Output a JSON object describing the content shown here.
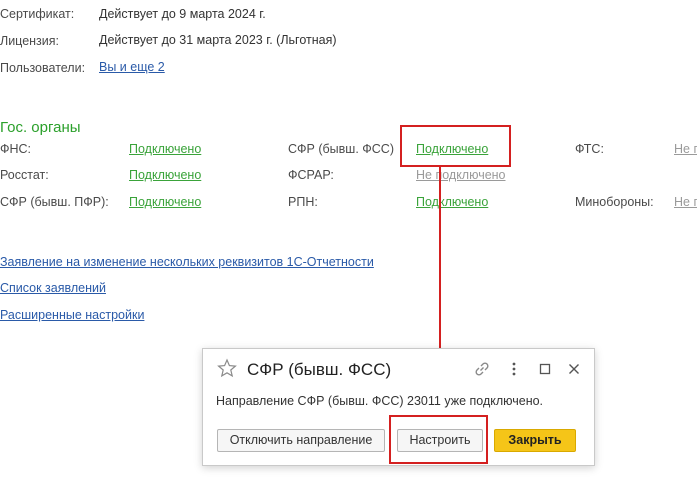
{
  "info": {
    "certificate_label": "Сертификат:",
    "certificate_value": "Действует до 9 марта 2024 г.",
    "license_label": "Лицензия:",
    "license_value": "Действует до 31 марта 2023 г. (Льготная)",
    "users_label": "Пользователи:",
    "users_link": "Вы и еще 2"
  },
  "agencies": {
    "title": "Гос. органы",
    "items": [
      {
        "name": "ФНС:",
        "status": "Подключено"
      },
      {
        "name": "СФР (бывш. ФСС)",
        "status": "Подключено"
      },
      {
        "name": "ФТС:",
        "status": "Не п"
      },
      {
        "name": "Росстат:",
        "status": "Подключено"
      },
      {
        "name": "ФСРАР:",
        "status": "Не подключено"
      },
      {
        "name": "СФР (бывш. ПФР):",
        "status": "Подключено"
      },
      {
        "name": "РПН:",
        "status": "Подключено"
      },
      {
        "name": "Минобороны:",
        "status": "Не п"
      }
    ]
  },
  "links": {
    "change_requisites": "Заявление на изменение нескольких реквизитов 1С-Отчетности",
    "applications_list": "Список заявлений",
    "advanced_settings": "Расширенные настройки"
  },
  "dialog": {
    "title": "СФР (бывш. ФСС)",
    "message": "Направление СФР (бывш. ФСС) 23011 уже подключено.",
    "disconnect_button": "Отключить направление",
    "configure_button": "Настроить",
    "close_button": "Закрыть",
    "icons": [
      "star-icon",
      "link-icon",
      "more-icon",
      "maximize-icon",
      "close-icon"
    ]
  },
  "colors": {
    "connected": "#3aa33a",
    "not_connected": "#9a9a9a",
    "link": "#2a5aa8",
    "section_title": "#2ba02b",
    "highlight": "#d42020",
    "primary_button": "#f5c518"
  }
}
